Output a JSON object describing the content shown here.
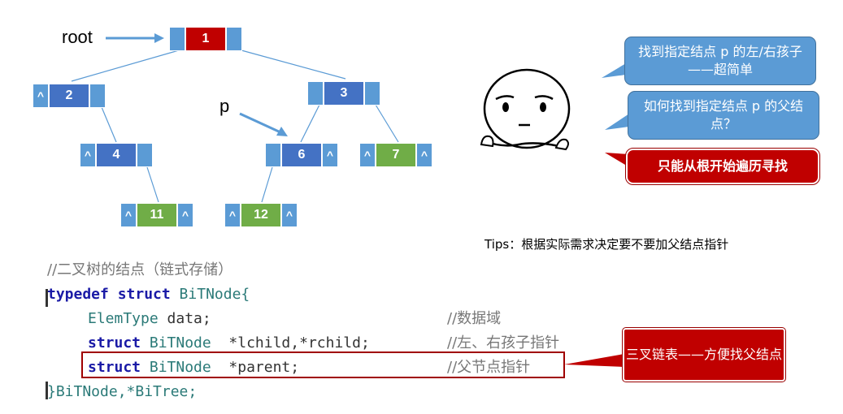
{
  "diagram": {
    "root_label": "root",
    "p_label": "p",
    "null_symbol": "^",
    "nodes": [
      {
        "id": "1",
        "color": "#c00000"
      },
      {
        "id": "2",
        "color": "#4472c4"
      },
      {
        "id": "3",
        "color": "#4472c4"
      },
      {
        "id": "4",
        "color": "#4472c4"
      },
      {
        "id": "6",
        "color": "#4472c4"
      },
      {
        "id": "7",
        "color": "#70ad47"
      },
      {
        "id": "11",
        "color": "#70ad47"
      },
      {
        "id": "12",
        "color": "#70ad47"
      }
    ]
  },
  "bubbles": {
    "b1": "找到指定结点 p 的左/右孩子——超简单",
    "b2": "如何找到指定结点 p 的父结点？",
    "b3": "只能从根开始遍历寻找"
  },
  "tips": "Tips：根据实际需求决定要不要加父结点指针",
  "code": {
    "comment_title": "//二叉树的结点（链式存储）",
    "l1_kw": "typedef struct",
    "l1_name": " BiTNode{",
    "l2_type": "ElemType",
    "l2_rest": " data;",
    "l2_cmt": "//数据域",
    "l3_kw": "struct",
    "l3_type": " BiTNode",
    "l3_rest": "  *lchild,*rchild;",
    "l3_cmt": "//左、右孩子指针",
    "l4_kw": "struct",
    "l4_type": " BiTNode",
    "l4_rest": "  *parent;",
    "l4_cmt": "//父节点指针",
    "l5": "}BiTNode,*BiTree;"
  },
  "callout": "三叉链表——方便找父结点"
}
